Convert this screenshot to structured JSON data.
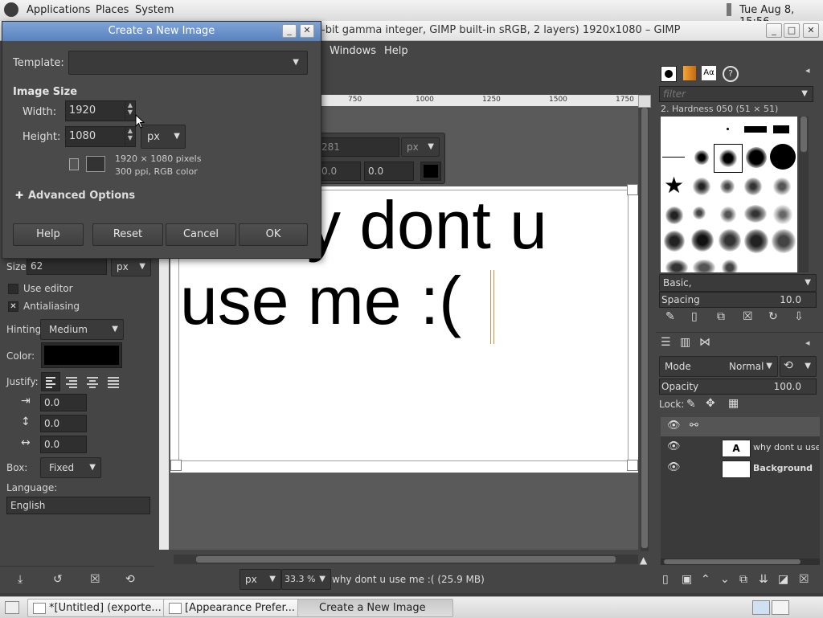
{
  "top_panel": {
    "applications": "Applications",
    "places": "Places",
    "system": "System",
    "clock": "Tue Aug  8, 15:56"
  },
  "gimp_window": {
    "title": "-bit gamma integer, GIMP built-in sRGB, 2 layers) 1920x1080 – GIMP",
    "menus": {
      "windows": "Windows",
      "help": "Help"
    }
  },
  "ruler": {
    "ticks": [
      "750",
      "1000",
      "1250",
      "1500",
      "1750"
    ]
  },
  "text_tool_overlay": {
    "value1": "281",
    "unit": "px",
    "x": "0.0",
    "y": "0.0"
  },
  "canvas": {
    "line1": "y dont u",
    "line2": "use me :("
  },
  "status": {
    "unit": "px",
    "zoom": "33.3 %",
    "message": "why dont u use me :( (25.9 MB)"
  },
  "tool_options": {
    "size_label": "Size:",
    "size_value": "62",
    "size_unit": "px",
    "use_editor": "Use editor",
    "antialiasing": "Antialiasing",
    "hinting_label": "Hinting:",
    "hinting_value": "Medium",
    "color_label": "Color:",
    "justify_label": "Justify:",
    "indent_value": "0.0",
    "line_spacing_value": "0.0",
    "letter_spacing_value": "0.0",
    "box_label": "Box:",
    "box_value": "Fixed",
    "language_label": "Language:",
    "language_value": "English"
  },
  "brushes": {
    "filter_placeholder": "filter",
    "selected_brush": "2. Hardness 050 (51 × 51)",
    "preset": "Basic,",
    "spacing_label": "Spacing",
    "spacing_value": "10.0"
  },
  "layers": {
    "mode_label": "Mode",
    "mode_value": "Normal",
    "opacity_label": "Opacity",
    "opacity_value": "100.0",
    "lock_label": "Lock:",
    "items": [
      {
        "name": "why dont u use m"
      },
      {
        "name": "Background"
      }
    ]
  },
  "dialog": {
    "title": "Create a New Image",
    "template_label": "Template:",
    "template_value": "",
    "image_size_heading": "Image Size",
    "width_label": "Width:",
    "width_value": "1920",
    "height_label": "Height:",
    "height_value": "1080",
    "unit": "px",
    "info_line1": "1920 × 1080 pixels",
    "info_line2": "300 ppi, RGB color",
    "advanced_options": "Advanced Options",
    "buttons": {
      "help": "Help",
      "reset": "Reset",
      "cancel": "Cancel",
      "ok": "OK"
    }
  },
  "taskbar": {
    "items": [
      {
        "label": "*[Untitled] (exporte..."
      },
      {
        "label": "[Appearance Prefer..."
      },
      {
        "label": "Create a New Image"
      }
    ]
  }
}
